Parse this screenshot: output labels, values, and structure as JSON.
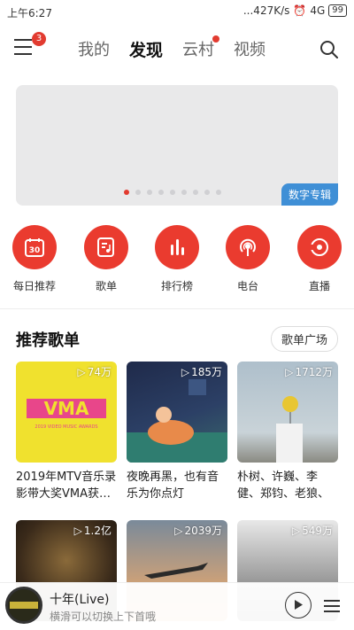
{
  "status_bar": {
    "time": "上午6:27",
    "speed": "...427K/s",
    "network": "4G",
    "battery": "99"
  },
  "header": {
    "menu_badge": "3",
    "tabs": [
      {
        "label": "我的",
        "active": false,
        "dot": false
      },
      {
        "label": "发现",
        "active": true,
        "dot": false
      },
      {
        "label": "云村",
        "active": false,
        "dot": true
      },
      {
        "label": "视频",
        "active": false,
        "dot": false
      }
    ]
  },
  "banner": {
    "tag": "数字专辑",
    "page_count": 9,
    "current_page": 1
  },
  "quick_entries": [
    {
      "label": "每日推荐",
      "icon": "calendar-icon",
      "day": "30"
    },
    {
      "label": "歌单",
      "icon": "playlist-icon"
    },
    {
      "label": "排行榜",
      "icon": "chart-bars-icon"
    },
    {
      "label": "电台",
      "icon": "radio-icon"
    },
    {
      "label": "直播",
      "icon": "live-icon"
    }
  ],
  "section": {
    "title": "推荐歌单",
    "more_label": "歌单广场"
  },
  "playlists": [
    {
      "count": "74万",
      "name": "2019年MTV音乐录影带大奖VMA获…",
      "cover_text": "2019 VIDEO MUSIC AWARDS"
    },
    {
      "count": "185万",
      "name": "夜晚再黑，也有音乐为你点灯"
    },
    {
      "count": "1712万",
      "name": "朴树、许巍、李健、郑钧、老狼、赵雷、"
    },
    {
      "count": "1.2亿",
      "name": ""
    },
    {
      "count": "2039万",
      "name": ""
    },
    {
      "count": "549万",
      "name": ""
    }
  ],
  "player": {
    "title": "十年(Live)",
    "hint": "横滑可以切换上下首哦"
  },
  "colors": {
    "brand_red": "#ea3b2f",
    "tag_blue": "#3f8fd6"
  }
}
